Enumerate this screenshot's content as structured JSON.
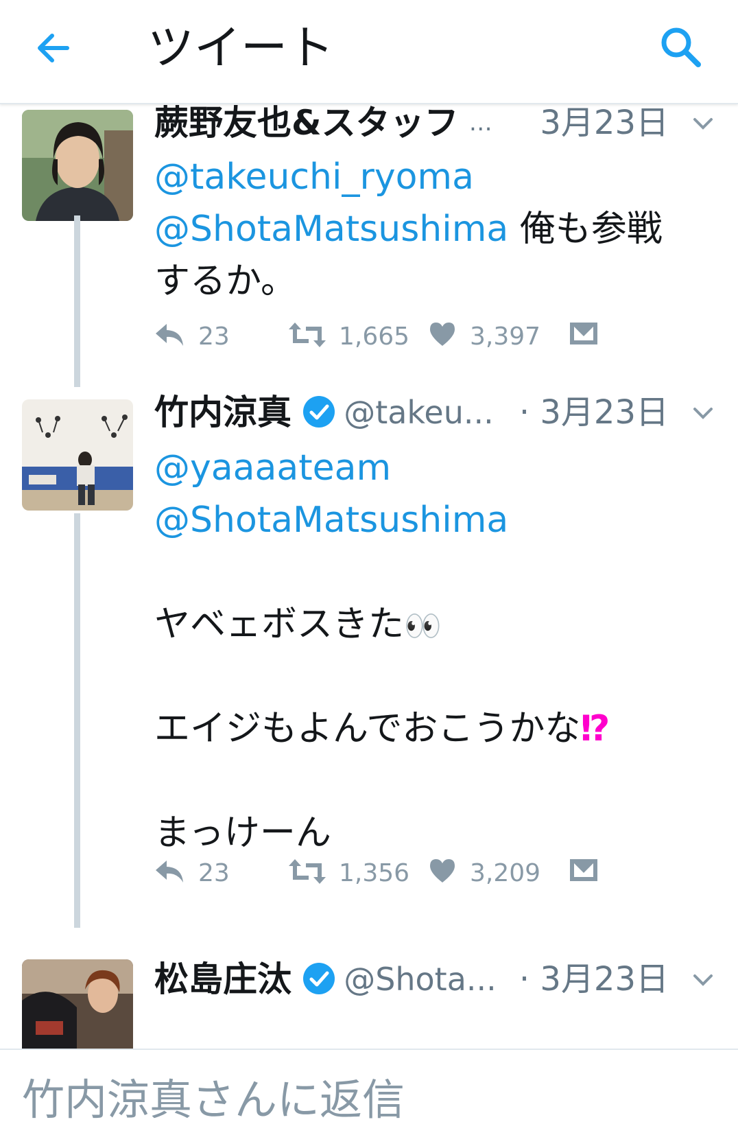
{
  "header": {
    "title": "ツイート",
    "back_icon": "arrow-left-icon",
    "search_icon": "search-icon",
    "accent": "#1da1f2"
  },
  "tweets": [
    {
      "name": "蕨野友也&スタッフ",
      "verified": false,
      "handle": "…",
      "date": "3月23日",
      "text": {
        "l1": "@takeuchi_ryoma",
        "l2_mention": "@ShotaMatsushima",
        "l2_rest": " 俺も参戦",
        "l3": "するか。"
      },
      "replies": "23",
      "retweets": "1,665",
      "likes": "3,397"
    },
    {
      "name": "竹内涼真",
      "verified": true,
      "handle": "@takeu...",
      "date": "· 3月23日",
      "text": {
        "l1": "@yaaaateam",
        "l2": "@ShotaMatsushima",
        "l3": "ヤベェボスきた",
        "l3_emoji": "👀",
        "l4": "エイジもよんでおこうかな",
        "l4_emoji": "⁉",
        "l5": "まっけーん"
      },
      "replies": "23",
      "retweets": "1,356",
      "likes": "3,209"
    },
    {
      "name": "松島庄汰",
      "verified": true,
      "handle": "@Shota...",
      "date": "· 3月23日"
    }
  ],
  "reply_bar": {
    "placeholder": "竹内涼真さんに返信"
  }
}
